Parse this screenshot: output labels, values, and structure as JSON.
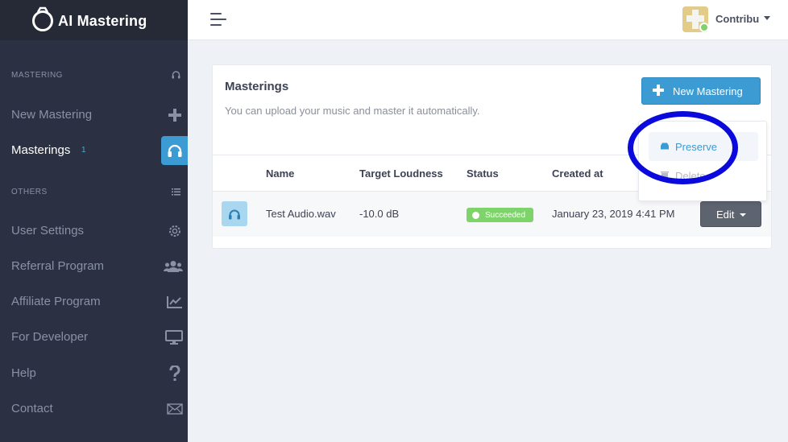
{
  "brand": {
    "name": "AI Mastering",
    "logo_icon": "ring-logo-icon"
  },
  "sidebar": {
    "sections": [
      {
        "heading": "MASTERING",
        "icon": "headphones-icon"
      },
      {
        "heading": "OTHERS",
        "icon": "list-icon"
      }
    ],
    "items": [
      {
        "label": "New Mastering",
        "icon": "plus-icon"
      },
      {
        "label": "Masterings",
        "badge": "1",
        "icon": "headphones-icon",
        "active": true
      },
      {
        "label": "User Settings",
        "icon": "gear-icon"
      },
      {
        "label": "Referral Program",
        "icon": "users-icon"
      },
      {
        "label": "Affiliate Program",
        "icon": "line-chart-icon"
      },
      {
        "label": "For Developer",
        "icon": "monitor-icon"
      },
      {
        "label": "Help",
        "icon": "question-icon"
      },
      {
        "label": "Contact",
        "icon": "envelope-icon"
      }
    ]
  },
  "topbar": {
    "user_name": "Contribu",
    "menu_icon": "hamburger-menu-icon"
  },
  "card": {
    "title": "Masterings",
    "subtitle": "You can upload your music and master it automatically.",
    "new_button_label": "New Mastering",
    "columns": [
      "Name",
      "Target Loudness",
      "Status",
      "Created at"
    ],
    "rows": [
      {
        "name": "Test Audio.wav",
        "target_loudness": "-10.0 dB",
        "status": "Succeeded",
        "created_at": "January 23, 2019 4:41 PM",
        "edit_label": "Edit"
      }
    ]
  },
  "dropdown": {
    "items": [
      {
        "label": "Preserve",
        "icon": "archive-icon"
      },
      {
        "label": "Delete",
        "icon": "trash-icon"
      }
    ]
  },
  "colors": {
    "sidebar_bg": "#2b3143",
    "accent": "#3c9bd3",
    "success": "#7ed36b",
    "highlight": "#0a0adc"
  }
}
